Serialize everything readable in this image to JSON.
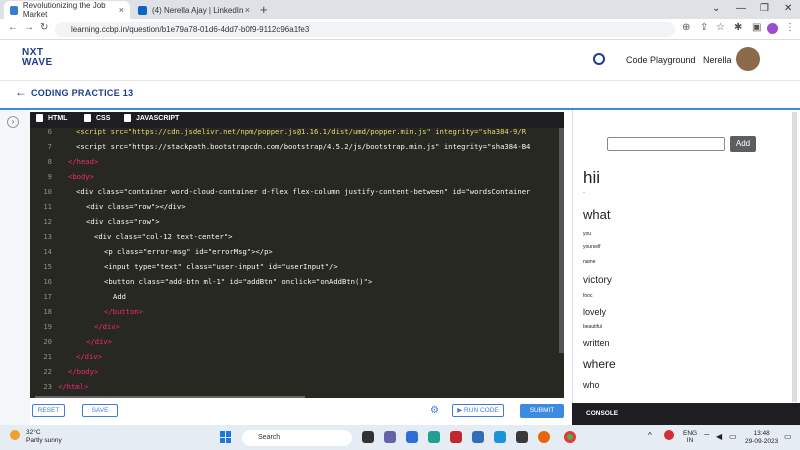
{
  "browser": {
    "tabs": [
      {
        "title": "Revolutionizing the Job Market",
        "close": "×"
      },
      {
        "title": "(4) Nerella Ajay | LinkedIn",
        "close": "×"
      }
    ],
    "new_tab": "+",
    "url": "learning.ccbp.in/question/b1e79a78-01d6-4dd7-b0f9-9112c96a1fe3",
    "window_controls": [
      "⌄",
      "—",
      "❐",
      "✕"
    ]
  },
  "header": {
    "logo": [
      "NXT",
      "WAVE"
    ],
    "code_playground": "Code Playground",
    "user_name": "Nerella",
    "page_title": "CODING PRACTICE 13",
    "back": "←"
  },
  "editor": {
    "tabs": [
      "HTML",
      "CSS",
      "JAVASCRIPT"
    ],
    "line_numbers": [
      "6",
      "7",
      "8",
      "9",
      "10",
      "11",
      "12",
      "13",
      "14",
      "15",
      "16",
      "17",
      "18",
      "19",
      "20",
      "21",
      "22",
      "23"
    ],
    "lines": [
      "<script src=\"https://cdn.jsdelivr.net/npm/popper.js@1.16.1/dist/umd/popper.min.js\" integrity=\"sha384-9/R",
      "<script src=\"https://stackpath.bootstrapcdn.com/bootstrap/4.5.2/js/bootstrap.min.js\" integrity=\"sha384-B4",
      "</head>",
      "<body>",
      "<div class=\"container word-cloud-container d-flex flex-column justify-content-between\" id=\"wordsContainer",
      "<div class=\"row\"></div>",
      "<div class=\"row\">",
      "<div class=\"col-12 text-center\">",
      "<p class=\"error-msg\" id=\"errorMsg\"></p>",
      "<input type=\"text\" class=\"user-input\" id=\"userInput\"/>",
      "<button class=\"add-btn ml-1\" id=\"addBtn\" onclick=\"onAddBtn()\">",
      "Add",
      "</button>",
      "</div>",
      "</div>",
      "</div>",
      "</body>",
      "</html>"
    ],
    "buttons": {
      "reset": "RESET",
      "save": "SAVE",
      "run": "▶ RUN CODE",
      "submit": "SUBMIT"
    }
  },
  "output": {
    "add_button": "Add",
    "words": [
      "hii",
      "-",
      "what",
      "you",
      "yourself",
      "name",
      "victory",
      "fooc",
      "lovely",
      "beautiful",
      "written",
      "where",
      "who"
    ],
    "console": "CONSOLE"
  },
  "taskbar": {
    "weather_temp": "32°C",
    "weather_desc": "Partly sunny",
    "search": "Search",
    "lang": "ENG",
    "region": "IN",
    "time": "13:48",
    "date": "29-09-2023"
  }
}
